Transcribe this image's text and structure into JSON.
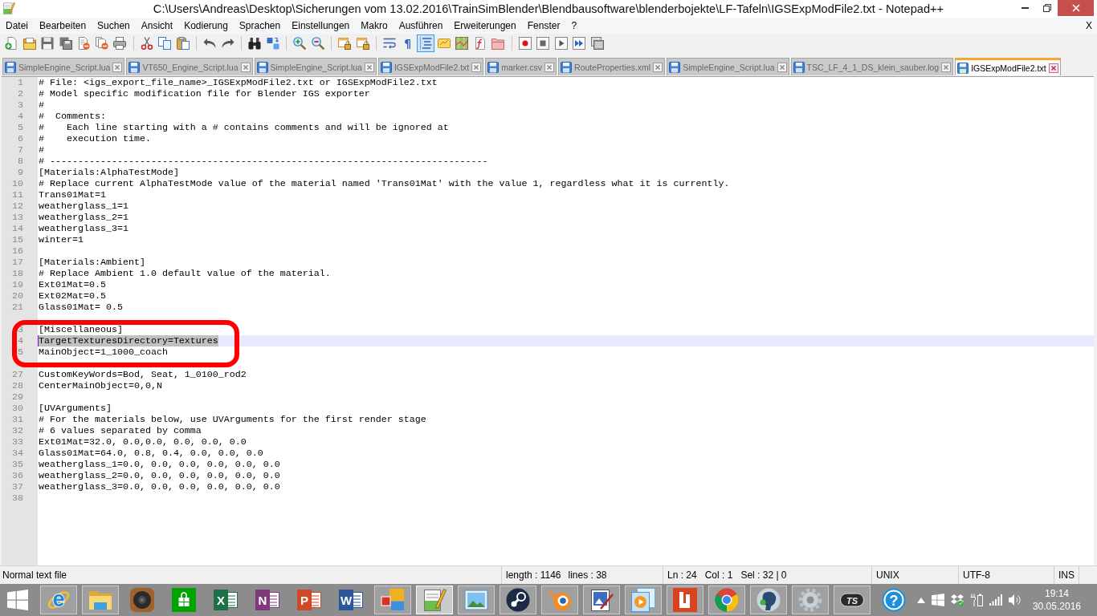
{
  "window": {
    "title": "C:\\Users\\Andreas\\Desktop\\Sicherungen vom 13.02.2016\\TrainSimBlender\\Blendbausoftware\\blenderbojekte\\LF-Tafeln\\IGSExpModFile2.txt - Notepad++"
  },
  "menu": {
    "items": [
      "Datei",
      "Bearbeiten",
      "Suchen",
      "Ansicht",
      "Kodierung",
      "Sprachen",
      "Einstellungen",
      "Makro",
      "Ausführen",
      "Erweiterungen",
      "Fenster",
      "?"
    ],
    "close_document": "X"
  },
  "toolbar": {
    "groups": [
      [
        {
          "kind": "new",
          "pressed": false
        },
        {
          "kind": "open",
          "pressed": false
        },
        {
          "kind": "save",
          "pressed": false
        },
        {
          "kind": "save-all",
          "pressed": false
        },
        {
          "kind": "close",
          "pressed": false
        },
        {
          "kind": "close-all",
          "pressed": false
        },
        {
          "kind": "print",
          "pressed": false
        }
      ],
      [
        {
          "kind": "cut",
          "pressed": false
        },
        {
          "kind": "copy",
          "pressed": false
        },
        {
          "kind": "paste",
          "pressed": false
        }
      ],
      [
        {
          "kind": "undo",
          "pressed": false
        },
        {
          "kind": "redo",
          "pressed": false
        }
      ],
      [
        {
          "kind": "find",
          "pressed": false
        },
        {
          "kind": "replace",
          "pressed": false
        }
      ],
      [
        {
          "kind": "zoom-in",
          "pressed": false
        },
        {
          "kind": "zoom-out",
          "pressed": false
        }
      ],
      [
        {
          "kind": "sync",
          "pressed": false
        },
        {
          "kind": "sync",
          "pressed": false
        }
      ],
      [
        {
          "kind": "wrap",
          "pressed": false
        },
        {
          "kind": "symbols",
          "glyph": "¶",
          "pressed": false
        },
        {
          "kind": "indent-guide",
          "pressed": true
        },
        {
          "kind": "language",
          "pressed": false
        },
        {
          "kind": "map",
          "pressed": false
        },
        {
          "kind": "function-list",
          "pressed": false
        },
        {
          "kind": "folder",
          "pressed": false
        }
      ],
      [
        {
          "kind": "record",
          "pressed": false
        },
        {
          "kind": "stop",
          "pressed": false
        },
        {
          "kind": "play",
          "pressed": false
        },
        {
          "kind": "play-multiple",
          "pressed": false
        },
        {
          "kind": "save-macro",
          "pressed": false
        }
      ]
    ]
  },
  "tabs": [
    {
      "label": "SimpleEngine_Script.lua",
      "selected": false
    },
    {
      "label": "VT650_Engine_Script.lua",
      "selected": false
    },
    {
      "label": "SimpleEngine_Script.lua",
      "selected": false
    },
    {
      "label": "IGSExpModFile2.txt",
      "selected": false
    },
    {
      "label": "marker.csv",
      "selected": false
    },
    {
      "label": "RouteProperties.xml",
      "selected": false
    },
    {
      "label": "SimpleEngine_Script.lua",
      "selected": false
    },
    {
      "label": "TSC_LF_4_1_DS_klein_sauber.log",
      "selected": false
    },
    {
      "label": "IGSExpModFile2.txt",
      "selected": true
    }
  ],
  "editor": {
    "lines": [
      {
        "number": "1",
        "text": "# File: <igs_export_file_name>_IGSExpModFile2.txt or IGSExpModFile2.txt",
        "current": false,
        "selected": false
      },
      {
        "number": "2",
        "text": "# Model specific modification file for Blender IGS exporter",
        "current": false,
        "selected": false
      },
      {
        "number": "3",
        "text": "#",
        "current": false,
        "selected": false
      },
      {
        "number": "4",
        "text": "#  Comments:",
        "current": false,
        "selected": false
      },
      {
        "number": "5",
        "text": "#    Each line starting with a # contains comments and will be ignored at",
        "current": false,
        "selected": false
      },
      {
        "number": "6",
        "text": "#    execution time.",
        "current": false,
        "selected": false
      },
      {
        "number": "7",
        "text": "#",
        "current": false,
        "selected": false
      },
      {
        "number": "8",
        "text": "# ------------------------------------------------------------------------------",
        "current": false,
        "selected": false
      },
      {
        "number": "9",
        "text": "[Materials:AlphaTestMode]",
        "current": false,
        "selected": false
      },
      {
        "number": "10",
        "text": "# Replace current AlphaTestMode value of the material named 'Trans01Mat' with the value 1, regardless what it is currently.",
        "current": false,
        "selected": false
      },
      {
        "number": "11",
        "text": "Trans01Mat=1",
        "current": false,
        "selected": false
      },
      {
        "number": "12",
        "text": "weatherglass_1=1",
        "current": false,
        "selected": false
      },
      {
        "number": "13",
        "text": "weatherglass_2=1",
        "current": false,
        "selected": false
      },
      {
        "number": "14",
        "text": "weatherglass_3=1",
        "current": false,
        "selected": false
      },
      {
        "number": "15",
        "text": "winter=1",
        "current": false,
        "selected": false
      },
      {
        "number": "16",
        "current": false,
        "selected": false
      },
      {
        "number": "17",
        "text": "[Materials:Ambient]",
        "current": false,
        "selected": false
      },
      {
        "number": "18",
        "text": "# Replace Ambient 1.0 default value of the material.",
        "current": false,
        "selected": false
      },
      {
        "number": "19",
        "text": "Ext01Mat=0.5",
        "current": false,
        "selected": false
      },
      {
        "number": "20",
        "text": "Ext02Mat=0.5",
        "current": false,
        "selected": false
      },
      {
        "number": "21",
        "text": "Glass01Mat= 0.5",
        "current": false,
        "selected": false
      },
      {
        "current": false,
        "selected": false
      },
      {
        "number": "3",
        "text": "[Miscellaneous]",
        "current": false,
        "selected": false
      },
      {
        "number": "4",
        "text": "TargetTexturesDirectory=Textures",
        "current": true,
        "selected": true
      },
      {
        "number": "5",
        "text": "MainObject=1_1000_coach",
        "current": false,
        "selected": false
      },
      {
        "current": false,
        "selected": false
      },
      {
        "number": "27",
        "text": "CustomKeyWords=Bod, Seat, 1_0100_rod2",
        "current": false,
        "selected": false
      },
      {
        "number": "28",
        "text": "CenterMainObject=0,0,N",
        "current": false,
        "selected": false
      },
      {
        "number": "29",
        "current": false,
        "selected": false
      },
      {
        "number": "30",
        "text": "[UVArguments]",
        "current": false,
        "selected": false
      },
      {
        "number": "31",
        "text": "# For the materials below, use UVArguments for the first render stage",
        "current": false,
        "selected": false
      },
      {
        "number": "32",
        "text": "# 6 values separated by comma",
        "current": false,
        "selected": false
      },
      {
        "number": "33",
        "text": "Ext01Mat=32.0, 0.0,0.0, 0.0, 0.0, 0.0",
        "current": false,
        "selected": false
      },
      {
        "number": "34",
        "text": "Glass01Mat=64.0, 0.8, 0.4, 0.0, 0.0, 0.0",
        "current": false,
        "selected": false
      },
      {
        "number": "35",
        "text": "weatherglass_1=0.0, 0.0, 0.0, 0.0, 0.0, 0.0",
        "current": false,
        "selected": false
      },
      {
        "number": "36",
        "text": "weatherglass_2=0.0, 0.0, 0.0, 0.0, 0.0, 0.0",
        "current": false,
        "selected": false
      },
      {
        "number": "37",
        "text": "weatherglass_3=0.0, 0.0, 0.0, 0.0, 0.0, 0.0",
        "current": false,
        "selected": false
      },
      {
        "number": "38",
        "current": false,
        "selected": false
      }
    ]
  },
  "status_bar": {
    "file_type": "Normal text file",
    "length": "length : 1146",
    "lines": "lines : 38",
    "line": "Ln : 24",
    "column": "Col : 1",
    "selection": "Sel : 32 | 0",
    "line_ending": "UNIX",
    "encoding": "UTF-8",
    "mode": "INS"
  },
  "taskbar": {
    "apps": [
      {
        "kind": "ring-letter",
        "label": "e",
        "running": true,
        "selected": false
      },
      {
        "kind": "folder",
        "running": true,
        "selected": false
      },
      {
        "kind": "speaker",
        "running": false,
        "selected": false
      },
      {
        "kind": "bag",
        "running": false,
        "selected": false
      },
      {
        "kind": "sheet",
        "label": "X",
        "running": false,
        "selected": false
      },
      {
        "kind": "notebook",
        "label": "N",
        "running": false,
        "selected": false
      },
      {
        "kind": "slides",
        "label": "P",
        "running": false,
        "selected": false
      },
      {
        "kind": "document",
        "label": "W",
        "running": false,
        "selected": false
      },
      {
        "kind": "squares",
        "running": true,
        "selected": false
      },
      {
        "kind": "notepad",
        "running": true,
        "selected": true
      },
      {
        "kind": "landscape",
        "running": true,
        "selected": false
      },
      {
        "kind": "piston",
        "running": true,
        "selected": false
      },
      {
        "kind": "ring-dot",
        "running": true,
        "selected": false
      },
      {
        "kind": "canvas",
        "running": true,
        "selected": false
      },
      {
        "kind": "play-pages",
        "running": true,
        "selected": false
      },
      {
        "kind": "tile",
        "running": true,
        "selected": false
      },
      {
        "kind": "segmented-circle",
        "running": true,
        "selected": false
      },
      {
        "kind": "head-profile",
        "running": true,
        "selected": false
      },
      {
        "kind": "gear",
        "running": true,
        "selected": false
      },
      {
        "kind": "pill",
        "label": "TS",
        "running": true,
        "selected": false
      },
      {
        "kind": "help",
        "label": "?",
        "running": false,
        "selected": false
      }
    ],
    "clock": {
      "time": "19:14",
      "date": "30.05.2016"
    }
  }
}
